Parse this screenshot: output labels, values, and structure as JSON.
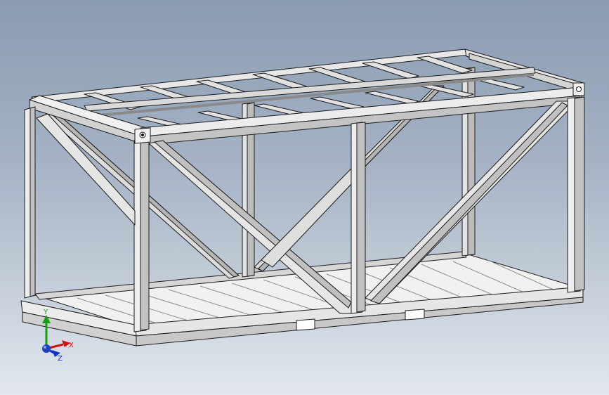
{
  "viewport": {
    "background_top": "#8a9cb3",
    "background_bottom": "#e3e8ee"
  },
  "model": {
    "steel_fill": "#e4e4e4",
    "steel_shade": "#b9b9b9",
    "edge_color": "#1a1a1a",
    "floor_fill": "#eeeeee"
  },
  "triad": {
    "x_label": "X",
    "y_label": "Y",
    "z_label": "Z",
    "x_color": "#d01010",
    "y_color": "#10a010",
    "z_color": "#1030d0"
  }
}
